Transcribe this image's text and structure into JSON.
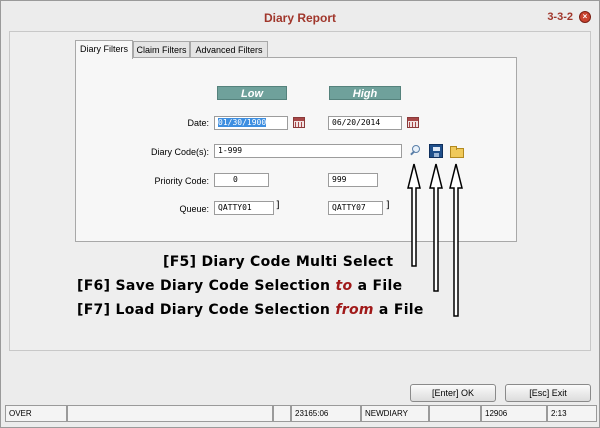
{
  "window": {
    "title": "Diary Report",
    "code": "3-3-2"
  },
  "tabs": [
    "Diary Filters",
    "Claim Filters",
    "Advanced Filters"
  ],
  "headers": {
    "low": "Low",
    "high": "High"
  },
  "fields": {
    "date": {
      "label": "Date:",
      "low": "01/30/1900",
      "high": "06/20/2014"
    },
    "diary_codes": {
      "label": "Diary Code(s):",
      "value": "1-999"
    },
    "priority": {
      "label": "Priority Code:",
      "low": "0",
      "high": "999"
    },
    "queue": {
      "label": "Queue:",
      "low": "QATTY01",
      "high": "QATTY07"
    }
  },
  "icons": {
    "search": "search-icon",
    "save": "save-icon",
    "load": "folder-open-icon",
    "calendar": "calendar-icon",
    "close": "close-icon"
  },
  "annotations": {
    "f5": "[F5] Diary Code Multi Select",
    "f6_pre": "[F6] Save Diary Code Selection ",
    "f6_em": "to",
    "f6_post": " a File",
    "f7_pre": "[F7] Load Diary Code Selection ",
    "f7_em": "from",
    "f7_post": " a File"
  },
  "buttons": {
    "ok": "[Enter] OK",
    "exit": "[Esc] Exit"
  },
  "status_bar": [
    "OVER",
    "",
    "",
    "23165:06",
    "NEWDIARY",
    "",
    "12906",
    "2:13"
  ],
  "colors": {
    "title": "#a0362b",
    "header_bg": "#6fa19b",
    "emphasis": "#a01919",
    "selection": "#3d8ee0"
  }
}
